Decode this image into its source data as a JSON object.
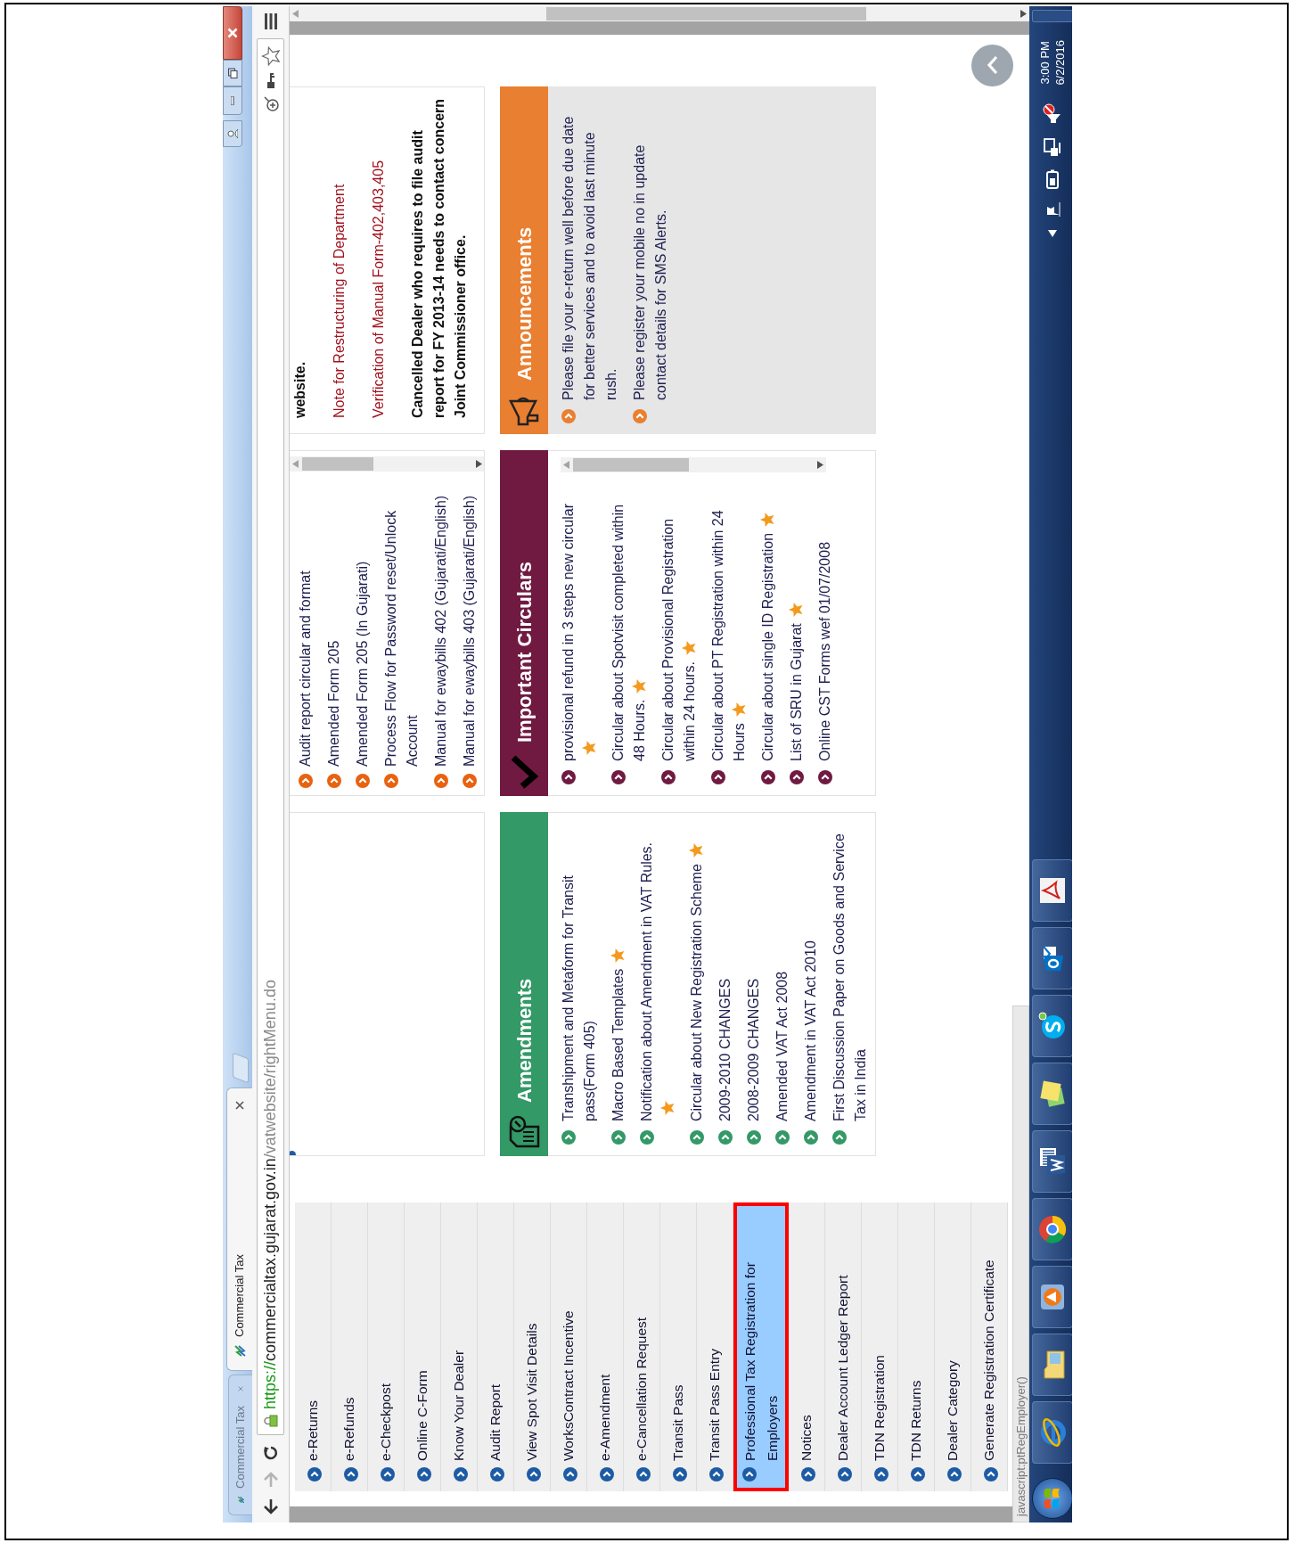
{
  "tabs": [
    {
      "title": "Commercial Tax",
      "selected": false
    },
    {
      "title": "Commercial Tax",
      "selected": true
    }
  ],
  "address_bar": {
    "scheme": "https://",
    "host": "commercialtax.gujarat.gov.in",
    "path": "/vatwebsite/rightMenu.do"
  },
  "sidebar": {
    "items": [
      {
        "label": "e-Returns",
        "selected": false
      },
      {
        "label": "e-Refunds",
        "selected": false
      },
      {
        "label": "e-Checkpost",
        "selected": false
      },
      {
        "label": "Online C-Form",
        "selected": false
      },
      {
        "label": "Know Your Dealer",
        "selected": false
      },
      {
        "label": "Audit Report",
        "selected": false
      },
      {
        "label": "View Spot Visit Details",
        "selected": false
      },
      {
        "label": "WorksContract Incentive",
        "selected": false
      },
      {
        "label": "e-Amendment",
        "selected": false
      },
      {
        "label": "e-Cancellation Request",
        "selected": false
      },
      {
        "label": "Transit Pass",
        "selected": false
      },
      {
        "label": "Transit Pass Entry",
        "selected": false
      },
      {
        "label": "Professional Tax Registration for Employers",
        "selected": true
      },
      {
        "label": "Notices",
        "selected": false
      },
      {
        "label": "Dealer Account Ledger Report",
        "selected": false
      },
      {
        "label": "TDN Registration",
        "selected": false
      },
      {
        "label": "TDN Returns",
        "selected": false
      },
      {
        "label": "Dealer Category",
        "selected": false
      },
      {
        "label": "Generate Registration Certificate",
        "selected": false
      }
    ]
  },
  "top_panels": [
    {
      "kind": "empty"
    },
    {
      "kind": "list",
      "items": [
        "Audit report circular and format",
        "Amended Form 205",
        "Amended Form 205 (In Gujarati)",
        "Process Flow for Password reset/Unlock Account",
        "Manual for ewaybills 402 (Gujarati/English)",
        "Manual for ewaybills 403 (Gujarati/English)"
      ]
    },
    {
      "kind": "notes",
      "notes": [
        {
          "text": "website.",
          "kind": "bold"
        },
        {
          "text": "Note for Restructuring of Department",
          "kind": "link"
        },
        {
          "text": "Verification of Manual Form-402,403,405",
          "kind": "link"
        },
        {
          "text": "Cancelled Dealer who requires to file audit report for FY 2013-14 needs to contact concern Joint Commissioner office.",
          "kind": "bold"
        }
      ]
    }
  ],
  "sections": [
    {
      "title": "Amendments",
      "color": "#339966",
      "kind": "plain",
      "items": [
        {
          "text": "Transhipment and Metaform for Transit pass(Form 405)",
          "new": false
        },
        {
          "text": "Macro Based Templates",
          "new": true
        },
        {
          "text": "Notification about Amendment in VAT Rules.",
          "new": true
        },
        {
          "text": "Circular about New Registration Scheme",
          "new": true
        },
        {
          "text": "2009-2010 CHANGES",
          "new": false
        },
        {
          "text": "2008-2009 CHANGES",
          "new": false
        },
        {
          "text": "Amended VAT Act 2008",
          "new": false
        },
        {
          "text": "Amendment in VAT Act 2010",
          "new": false
        },
        {
          "text": "First Discussion Paper on Goods and Service Tax in India",
          "new": false
        }
      ]
    },
    {
      "title": "Important Circulars",
      "color": "#701a42",
      "kind": "scroll",
      "items": [
        {
          "text": "provisional refund in 3 steps new circular",
          "new": true
        },
        {
          "text": "Circular about Spotvisit completed within 48 Hours.",
          "new": true
        },
        {
          "text": "Circular about Provisional Registration within 24 hours.",
          "new": true
        },
        {
          "text": "Circular about PT Registration within 24 Hours",
          "new": true
        },
        {
          "text": "Circular about single ID Registration",
          "new": true
        },
        {
          "text": "List of SRU in Gujarat",
          "new": true
        },
        {
          "text": "Online CST Forms wef 01/07/2008",
          "new": false
        }
      ]
    },
    {
      "title": "Announcements",
      "color": "#e97f30",
      "kind": "shaded",
      "items": [
        {
          "text": "Please file your e-return well before due date for better services and to avoid last minute rush.",
          "new": false
        },
        {
          "text": "Please register your mobile no in update contact details for SMS Alerts.",
          "new": false
        }
      ]
    }
  ],
  "status_text": "javascript:ptRegEmployer()",
  "clock": {
    "time": "3:00 PM",
    "date": "6/2/2016"
  }
}
